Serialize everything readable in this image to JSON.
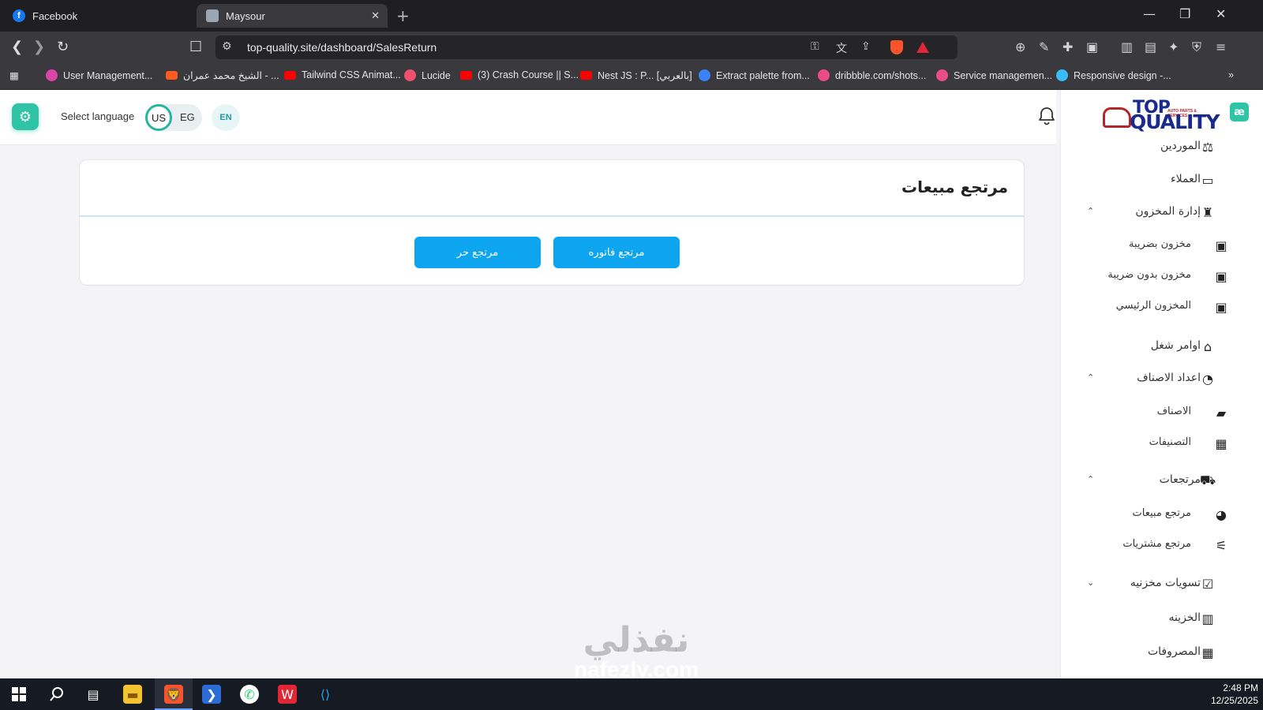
{
  "browser": {
    "tabs": [
      {
        "title": "Facebook",
        "active": false,
        "icon": "facebook-icon"
      },
      {
        "title": "Maysour",
        "active": true,
        "icon": "site-favicon"
      }
    ],
    "url": "top-quality.site/dashboard/SalesReturn",
    "bookmarks": [
      {
        "label": "User Management...",
        "icon_color": "#d946a8"
      },
      {
        "label": "الشيخ محمد عمران - ...",
        "icon_color": "#ff5a1f"
      },
      {
        "label": "Tailwind CSS Animat...",
        "icon_color": "#ff0000"
      },
      {
        "label": "Lucide",
        "icon_color": "#f0506e"
      },
      {
        "label": "(3) Crash Course || S...",
        "icon_color": "#ff0000"
      },
      {
        "label": "Nest JS : P... [بالعربي]",
        "icon_color": "#ff0000"
      },
      {
        "label": "Extract palette from...",
        "icon_color": "#3b82f6"
      },
      {
        "label": "dribbble.com/shots...",
        "icon_color": "#ea4c89"
      },
      {
        "label": "Service managemen...",
        "icon_color": "#ea4c89"
      },
      {
        "label": "Responsive design -...",
        "icon_color": "#38bdf8"
      }
    ]
  },
  "header": {
    "select_language_label": "Select language",
    "lang_us": "US",
    "lang_eg": "EG",
    "lang_current": "EN"
  },
  "logo": {
    "line1": "TOP",
    "line2": "QUALITY",
    "sub": "AUTO PARTS & SERVICES",
    "app_icon": "æ"
  },
  "main": {
    "title": "مرتجع مبيعات",
    "invoice_return_button": "مرتجع فاتوره",
    "free_return_button": "مرتجع حر"
  },
  "sidebar": {
    "items": [
      {
        "label": "الموردين",
        "icon": "suppliers-icon",
        "indent": false
      },
      {
        "label": "العملاء",
        "icon": "customers-card-icon",
        "indent": false
      },
      {
        "label": "إدارة المخزون",
        "icon": "inventory-icon",
        "indent": false,
        "chevron": "up"
      },
      {
        "label": "مخزون بضريبة",
        "icon": "archive-box-icon",
        "indent": true
      },
      {
        "label": "مخزون بدون ضريبة",
        "icon": "archive-box-icon",
        "indent": true
      },
      {
        "label": "المخزون الرئيسي",
        "icon": "archive-box-icon",
        "indent": true
      },
      {
        "label": "اوامر شغل",
        "icon": "work-orders-icon",
        "indent": false
      },
      {
        "label": "اعداد الاصناف",
        "icon": "items-setup-icon",
        "indent": false,
        "chevron": "up"
      },
      {
        "label": "الاصناف",
        "icon": "package-icon",
        "indent": true
      },
      {
        "label": "التصنيفات",
        "icon": "categories-grid-icon",
        "indent": true
      },
      {
        "label": "مرتجعات",
        "icon": "returns-truck-icon",
        "indent": false,
        "chevron": "up"
      },
      {
        "label": "مرتجع مبيعات",
        "icon": "sales-return-icon",
        "indent": true
      },
      {
        "label": "مرتجع مشتريات",
        "icon": "purchase-return-icon",
        "indent": true
      },
      {
        "label": "تسويات مخزنيه",
        "icon": "clipboard-check-icon",
        "indent": false,
        "chevron": "down"
      },
      {
        "label": "الخزينه",
        "icon": "treasury-icon",
        "indent": false
      },
      {
        "label": "المصروفات",
        "icon": "expenses-icon",
        "indent": false
      }
    ]
  },
  "watermark": {
    "arabic": "نفذلي",
    "latin": "nafezly.com"
  },
  "taskbar": {
    "time": "2:48 PM",
    "date": "12/25/2025"
  }
}
